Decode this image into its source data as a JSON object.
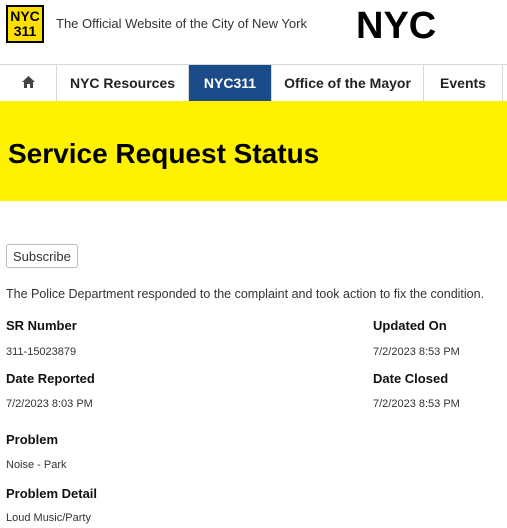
{
  "header": {
    "logo_text": [
      "NYC",
      "311"
    ],
    "tagline": "The Official Website of the City of New York",
    "brand_logo": "NYC"
  },
  "nav": {
    "items": [
      {
        "label": "",
        "icon": "home-icon",
        "active": false
      },
      {
        "label": "NYC Resources",
        "active": false
      },
      {
        "label": "NYC311",
        "active": true
      },
      {
        "label": "Office of the Mayor",
        "active": false
      },
      {
        "label": "Events",
        "active": false
      }
    ]
  },
  "banner": {
    "title": "Service Request Status"
  },
  "subscribe_label": "Subscribe",
  "status_message": "The Police Department responded to the complaint and took action to fix the condition.",
  "details": {
    "sr_number": {
      "label": "SR Number",
      "value": "311-15023879"
    },
    "updated_on": {
      "label": "Updated On",
      "value": "7/2/2023 8:53 PM"
    },
    "date_reported": {
      "label": "Date Reported",
      "value": "7/2/2023 8:03 PM"
    },
    "date_closed": {
      "label": "Date Closed",
      "value": "7/2/2023 8:53 PM"
    },
    "problem": {
      "label": "Problem",
      "value": "Noise - Park"
    },
    "problem_detail": {
      "label": "Problem Detail",
      "value": "Loud Music/Party"
    }
  },
  "colors": {
    "banner_yellow": "#fff200",
    "logo_yellow": "#fee000",
    "nav_active": "#1c4b8a"
  }
}
